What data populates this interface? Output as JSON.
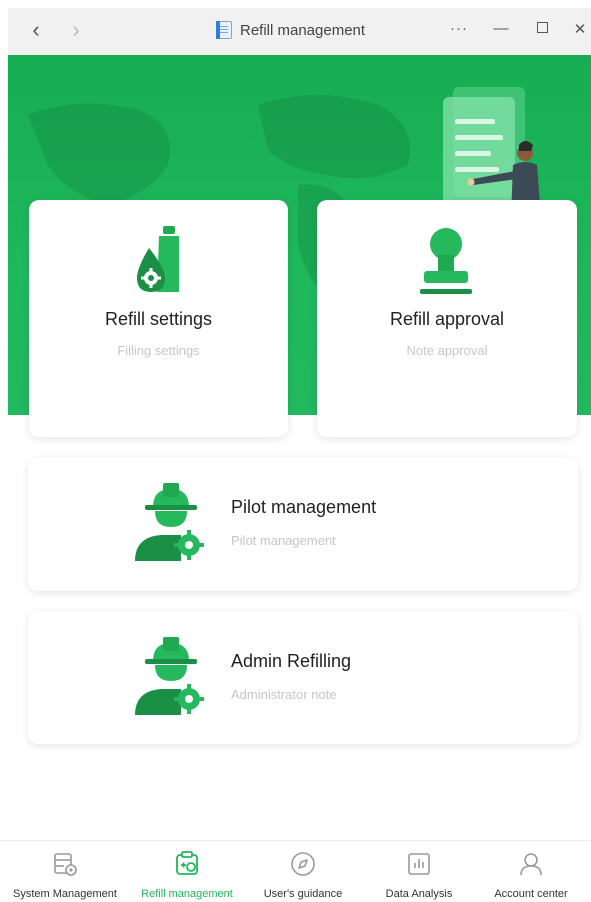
{
  "window": {
    "title": "Refill management",
    "back_glyph": "‹",
    "forward_glyph": "›",
    "more_glyph": "···",
    "minimize_glyph": "—",
    "close_glyph": "✕"
  },
  "colors": {
    "brand_green": "#22b55b",
    "banner_green": "#1fb85c",
    "subtitle_gray": "#c7c7c7"
  },
  "cards": {
    "settings": {
      "title": "Refill settings",
      "subtitle": "Filling settings",
      "icon": "oil-refill-icon"
    },
    "approval": {
      "title": "Refill approval",
      "subtitle": "Note approval",
      "icon": "stamp-icon"
    },
    "pilot": {
      "title": "Pilot management",
      "subtitle": "Pilot management",
      "icon": "pilot-worker-icon"
    },
    "admin": {
      "title": "Admin Refilling",
      "subtitle": "Administrator note",
      "icon": "admin-worker-icon"
    }
  },
  "bottom_nav": {
    "items": [
      {
        "label": "System Management",
        "icon": "system-management-icon",
        "active": false
      },
      {
        "label": "Refill management",
        "icon": "refill-management-icon",
        "active": true
      },
      {
        "label": "User's guidance",
        "icon": "compass-icon",
        "active": false
      },
      {
        "label": "Data Analysis",
        "icon": "bar-chart-icon",
        "active": false
      },
      {
        "label": "Account center",
        "icon": "user-icon",
        "active": false
      }
    ]
  }
}
